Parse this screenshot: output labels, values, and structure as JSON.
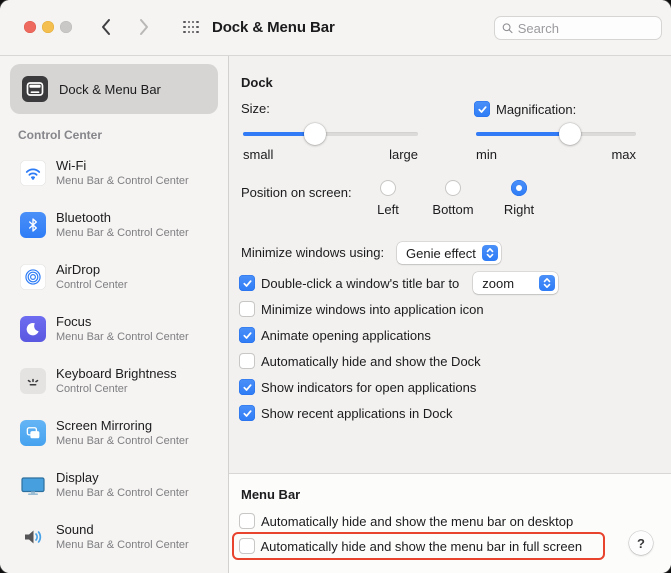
{
  "window": {
    "title": "Dock & Menu Bar"
  },
  "toolbar": {
    "search_placeholder": "Search"
  },
  "sidebar": {
    "selected": {
      "label": "Dock & Menu Bar"
    },
    "section_header": "Control Center",
    "items": [
      {
        "label": "Wi-Fi",
        "subtitle": "Menu Bar & Control Center",
        "icon": "wifi-icon"
      },
      {
        "label": "Bluetooth",
        "subtitle": "Menu Bar & Control Center",
        "icon": "bluetooth-icon"
      },
      {
        "label": "AirDrop",
        "subtitle": "Control Center",
        "icon": "airdrop-icon"
      },
      {
        "label": "Focus",
        "subtitle": "Menu Bar & Control Center",
        "icon": "focus-icon"
      },
      {
        "label": "Keyboard Brightness",
        "subtitle": "Control Center",
        "icon": "keyboard-brightness-icon"
      },
      {
        "label": "Screen Mirroring",
        "subtitle": "Menu Bar & Control Center",
        "icon": "screen-mirroring-icon"
      },
      {
        "label": "Display",
        "subtitle": "Menu Bar & Control Center",
        "icon": "display-icon"
      },
      {
        "label": "Sound",
        "subtitle": "Menu Bar & Control Center",
        "icon": "sound-icon"
      }
    ]
  },
  "dock_section": {
    "heading": "Dock",
    "size": {
      "label": "Size:",
      "min_label": "small",
      "max_label": "large",
      "value_percent": 41
    },
    "magnification": {
      "label": "Magnification:",
      "checked": true,
      "min_label": "min",
      "max_label": "max",
      "value_percent": 59
    },
    "position": {
      "label": "Position on screen:",
      "options": [
        {
          "label": "Left",
          "selected": false
        },
        {
          "label": "Bottom",
          "selected": false
        },
        {
          "label": "Right",
          "selected": true
        }
      ]
    },
    "minimize_effect": {
      "label": "Minimize windows using:",
      "value": "Genie effect"
    },
    "checkboxes": [
      {
        "label": "Double-click a window's title bar to",
        "checked": true,
        "dropdown_value": "zoom"
      },
      {
        "label": "Minimize windows into application icon",
        "checked": false
      },
      {
        "label": "Animate opening applications",
        "checked": true
      },
      {
        "label": "Automatically hide and show the Dock",
        "checked": false
      },
      {
        "label": "Show indicators for open applications",
        "checked": true
      },
      {
        "label": "Show recent applications in Dock",
        "checked": true
      }
    ]
  },
  "menu_bar_section": {
    "heading": "Menu Bar",
    "checkboxes": [
      {
        "label": "Automatically hide and show the menu bar on desktop",
        "checked": false
      },
      {
        "label": "Automatically hide and show the menu bar in full screen",
        "checked": false,
        "highlighted": true
      }
    ],
    "help_label": "?"
  },
  "colors": {
    "accent": "#2e7cf6",
    "annotation_red": "#e8432d",
    "selected_row_bg": "#d6d5d3"
  }
}
